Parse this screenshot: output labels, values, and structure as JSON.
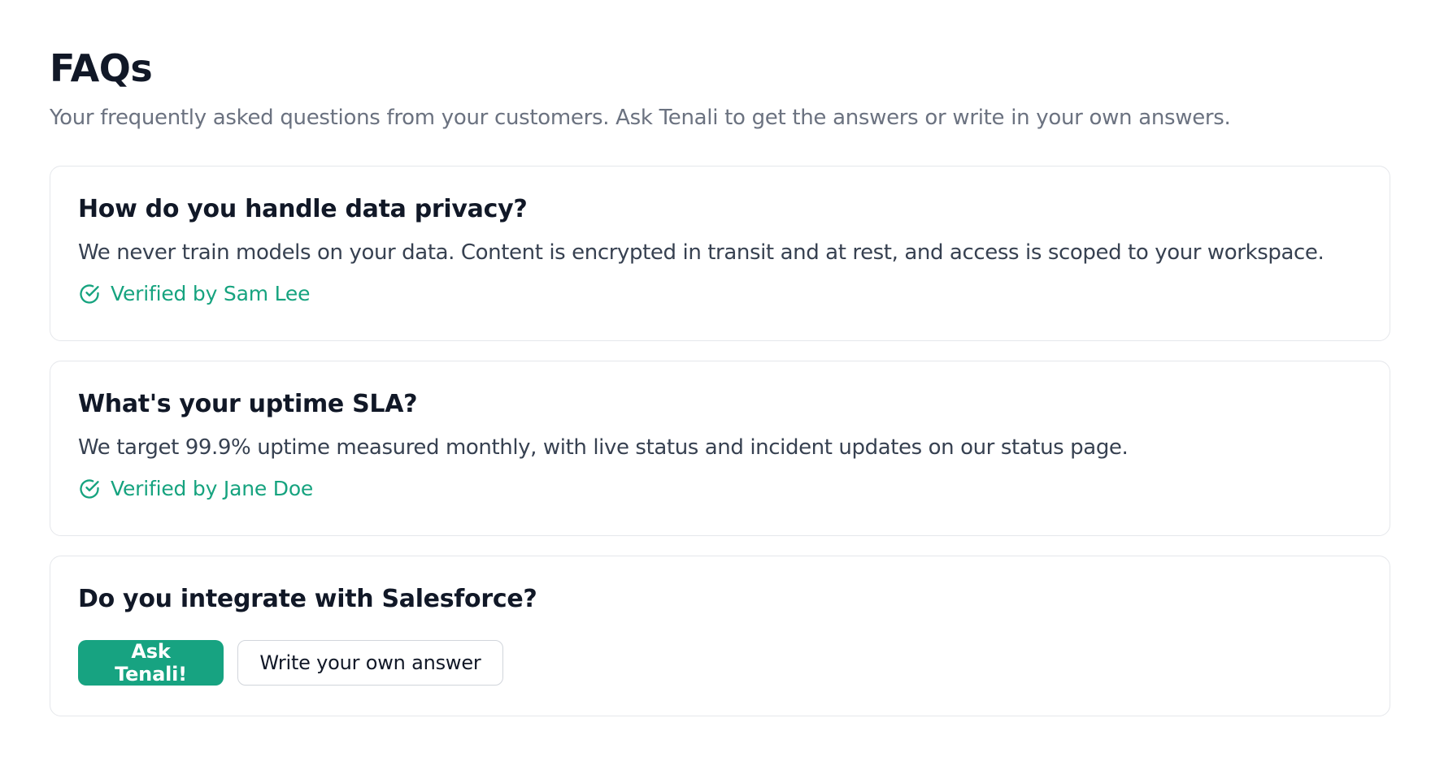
{
  "header": {
    "title": "FAQs",
    "subtitle": "Your frequently asked questions from your customers. Ask Tenali to get the answers or write in your own answers."
  },
  "faqs": [
    {
      "question": "How do you handle data privacy?",
      "answer": "We never train models on your data. Content is encrypted in transit and at rest, and access is scoped to your workspace.",
      "verified_label": "Verified by Sam Lee",
      "icon": "check-circle-icon"
    },
    {
      "question": "What's your uptime SLA?",
      "answer": "We target 99.9% uptime measured monthly, with live status and incident updates on our status page.",
      "verified_label": "Verified by Jane Doe",
      "icon": "check-circle-icon"
    },
    {
      "question": "Do you integrate with Salesforce?",
      "ask_button_label": "Ask Tenali!",
      "write_button_label": "Write your own answer"
    }
  ],
  "colors": {
    "accent": "#17a381",
    "verified_text": "#16a37f",
    "heading": "#111827",
    "muted": "#6b7280",
    "border": "#e5e7eb"
  }
}
